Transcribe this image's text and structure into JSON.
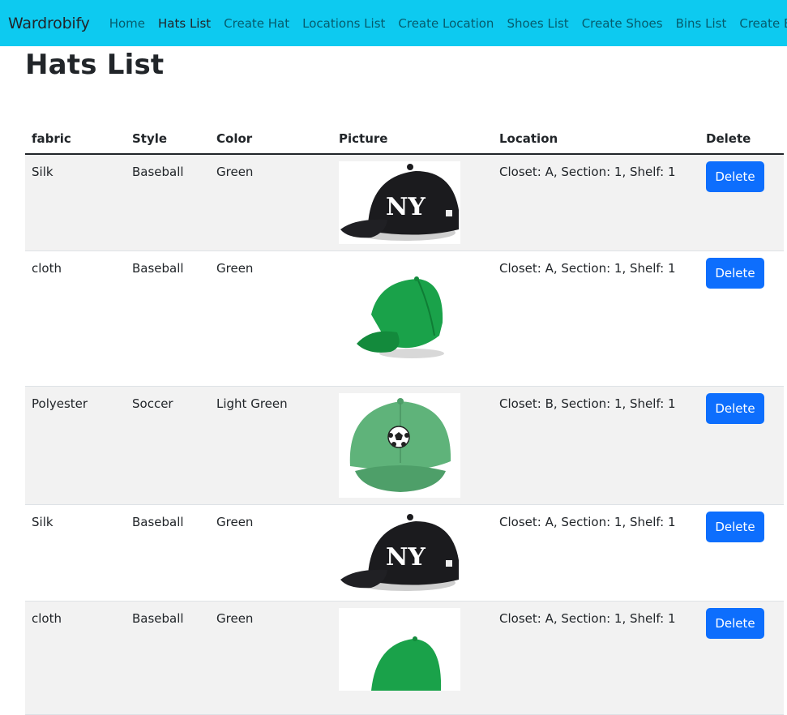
{
  "nav": {
    "brand": "Wardrobify",
    "links": [
      "Home",
      "Hats List",
      "Create Hat",
      "Locations List",
      "Create Location",
      "Shoes List",
      "Create Shoes",
      "Bins List",
      "Create Bin"
    ],
    "active": "Hats List"
  },
  "page": {
    "title": "Hats List"
  },
  "table": {
    "headers": [
      "fabric",
      "Style",
      "Color",
      "Picture",
      "Location",
      "Delete"
    ],
    "rows": [
      {
        "fabric": "Silk",
        "style": "Baseball",
        "color": "Green",
        "picture": "black-yankees-cap",
        "location": "Closet: A, Section: 1, Shelf: 1",
        "action": "Delete"
      },
      {
        "fabric": "cloth",
        "style": "Baseball",
        "color": "Green",
        "picture": "green-baseball-cap",
        "location": "Closet: A, Section: 1, Shelf: 1",
        "action": "Delete"
      },
      {
        "fabric": "Polyester",
        "style": "Soccer",
        "color": "Light Green",
        "picture": "light-green-soccer-cap",
        "location": "Closet: B, Section: 1, Shelf: 1",
        "action": "Delete"
      },
      {
        "fabric": "Silk",
        "style": "Baseball",
        "color": "Green",
        "picture": "black-yankees-cap",
        "location": "Closet: A, Section: 1, Shelf: 1",
        "action": "Delete"
      },
      {
        "fabric": "cloth",
        "style": "Baseball",
        "color": "Green",
        "picture": "green-baseball-cap",
        "location": "Closet: A, Section: 1, Shelf: 1",
        "action": "Delete"
      }
    ]
  },
  "colors": {
    "navbar": "#0dcaf0",
    "button": "#0d6efd",
    "stripe": "#f2f2f2"
  }
}
